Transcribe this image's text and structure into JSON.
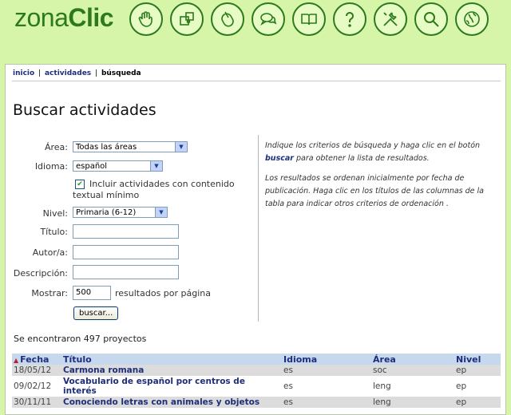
{
  "brand": {
    "part1": "zona",
    "part2": "Clic"
  },
  "nav_icons": [
    {
      "name": "hand-icon"
    },
    {
      "name": "puzzle-icon"
    },
    {
      "name": "mouse-icon"
    },
    {
      "name": "chat-bubbles-icon"
    },
    {
      "name": "open-book-icon"
    },
    {
      "name": "help-question-icon"
    },
    {
      "name": "tools-icon"
    },
    {
      "name": "magnifier-search-icon"
    },
    {
      "name": "globe-icon"
    }
  ],
  "breadcrumb": {
    "inicio": "inicio",
    "actividades": "actividades",
    "current": "búsqueda",
    "sep": "|"
  },
  "page_title": "Buscar actividades",
  "form": {
    "area_label": "Área:",
    "area_value": "Todas las áreas",
    "idioma_label": "Idioma:",
    "idioma_value": "español",
    "include_line1": "Incluir actividades con contenido",
    "include_line2": "textual mínimo",
    "include_checked": true,
    "nivel_label": "Nivel:",
    "nivel_value": "Primaria (6-12)",
    "titulo_label": "Título:",
    "autor_label": "Autor/a:",
    "descripcion_label": "Descripción:",
    "mostrar_label": "Mostrar:",
    "mostrar_value": "500",
    "mostrar_suffix": "resultados por página",
    "buscar_button": "buscar..."
  },
  "help": {
    "p1_a": "Indique los criterios de búsqueda y haga clic en el botón",
    "p1_b": "buscar",
    "p1_c": "para obtener la lista de resultados.",
    "p2": "Los resultados se ordenan inicialmente por fecha de publicación. Haga clic en los títulos de las columnas de la tabla para indicar otros criterios de ordenación ."
  },
  "found_text": "Se encontraron 497 proyectos",
  "table": {
    "headers": {
      "fecha": "Fecha",
      "titulo": "Título",
      "idioma": "Idioma",
      "area": "Área",
      "nivel": "Nivel"
    },
    "rows": [
      {
        "fecha": "18/05/12",
        "titulo": "Carmona romana",
        "idioma": "es",
        "area": "soc",
        "nivel": "ep"
      },
      {
        "fecha": "09/02/12",
        "titulo": "Vocabulario de español por centros de interés",
        "idioma": "es",
        "area": "leng",
        "nivel": "ep"
      },
      {
        "fecha": "30/11/11",
        "titulo": "Conociendo letras con animales y objetos",
        "idioma": "es",
        "area": "leng",
        "nivel": "ep"
      }
    ]
  },
  "colors": {
    "background": "#d6f5a8",
    "brand_green": "#2d7a1c",
    "link_blue": "#1e2e7a",
    "table_header": "#c6d8ee",
    "sort_arrow": "#c0202c"
  }
}
